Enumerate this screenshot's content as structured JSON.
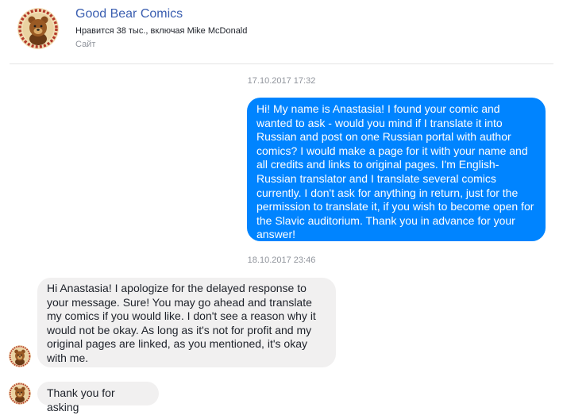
{
  "header": {
    "page_name": "Good Bear Comics",
    "likes": "Нравится 38 тыс., включая Mike McDonald",
    "category": "Сайт",
    "avatar_icon": "bear-logo-icon"
  },
  "conversation": {
    "timestamp_1": "17.10.2017 17:32",
    "outgoing_message": "Hi! My name is Anastasia! I found your comic and\nwanted to ask - would you mind if I translate it into\nRussian and post on one Russian portal with author\ncomics? I would make a page for it with your name and\nall credits and links to original pages. I'm English-\nRussian translator and I translate several comics\ncurrently. I don't ask for anything in return, just for the\npermission to translate it, if you wish to become open for\nthe Slavic auditorium. Thank you in advance for your\nanswer!",
    "timestamp_2": "18.10.2017 23:46",
    "reply_1": "Hi Anastasia! I apologize for the delayed response to\nyour message. Sure! You may go ahead and translate\nmy comics if you would like. I don't see a reason why it\nwould not be okay.  As long as it's not for profit and my\noriginal pages are linked, as you mentioned, it's okay\nwith me.",
    "reply_2": "Thank you for asking"
  },
  "colors": {
    "outgoing_bubble": "#0084ff",
    "incoming_bubble": "#f1f0f0",
    "link": "#3a5eb0"
  }
}
